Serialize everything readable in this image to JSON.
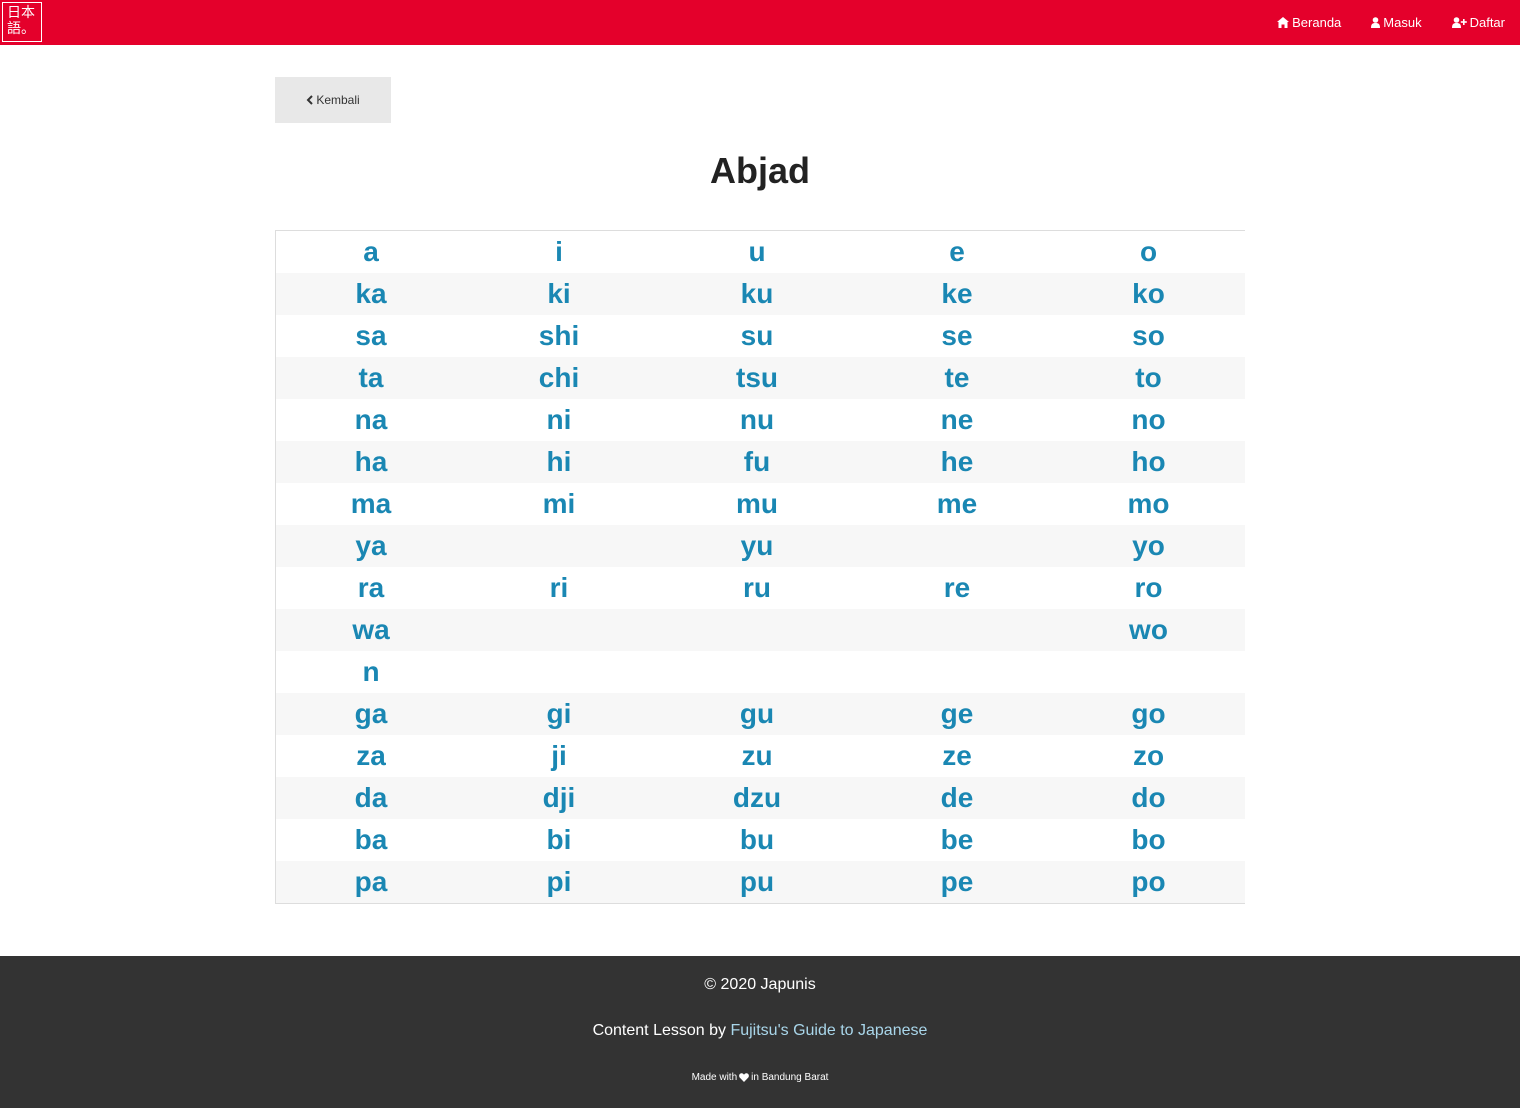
{
  "header": {
    "logo_text": "日本語。",
    "nav": [
      {
        "label": "Beranda",
        "icon": "home-icon"
      },
      {
        "label": "Masuk",
        "icon": "user-icon"
      },
      {
        "label": "Daftar",
        "icon": "user-plus-icon"
      }
    ]
  },
  "back_button": {
    "label": "Kembali",
    "icon": "chevron-left-icon"
  },
  "page_title": "Abjad",
  "alphabet_table": [
    [
      "a",
      "i",
      "u",
      "e",
      "o"
    ],
    [
      "ka",
      "ki",
      "ku",
      "ke",
      "ko"
    ],
    [
      "sa",
      "shi",
      "su",
      "se",
      "so"
    ],
    [
      "ta",
      "chi",
      "tsu",
      "te",
      "to"
    ],
    [
      "na",
      "ni",
      "nu",
      "ne",
      "no"
    ],
    [
      "ha",
      "hi",
      "fu",
      "he",
      "ho"
    ],
    [
      "ma",
      "mi",
      "mu",
      "me",
      "mo"
    ],
    [
      "ya",
      "",
      "yu",
      "",
      "yo"
    ],
    [
      "ra",
      "ri",
      "ru",
      "re",
      "ro"
    ],
    [
      "wa",
      "",
      "",
      "",
      "wo"
    ],
    [
      "n",
      "",
      "",
      "",
      ""
    ],
    [
      "ga",
      "gi",
      "gu",
      "ge",
      "go"
    ],
    [
      "za",
      "ji",
      "zu",
      "ze",
      "zo"
    ],
    [
      "da",
      "dji",
      "dzu",
      "de",
      "do"
    ],
    [
      "ba",
      "bi",
      "bu",
      "be",
      "bo"
    ],
    [
      "pa",
      "pi",
      "pu",
      "pe",
      "po"
    ]
  ],
  "footer": {
    "copyright": "© 2020 Japunis",
    "credit_prefix": "Content Lesson by ",
    "credit_link": "Fujitsu's Guide to Japanese",
    "made_prefix": "Made with",
    "made_suffix": "in Bandung Barat"
  },
  "colors": {
    "navbar": "#e4002b",
    "link": "#1a87b3",
    "footer_bg": "#333333"
  }
}
